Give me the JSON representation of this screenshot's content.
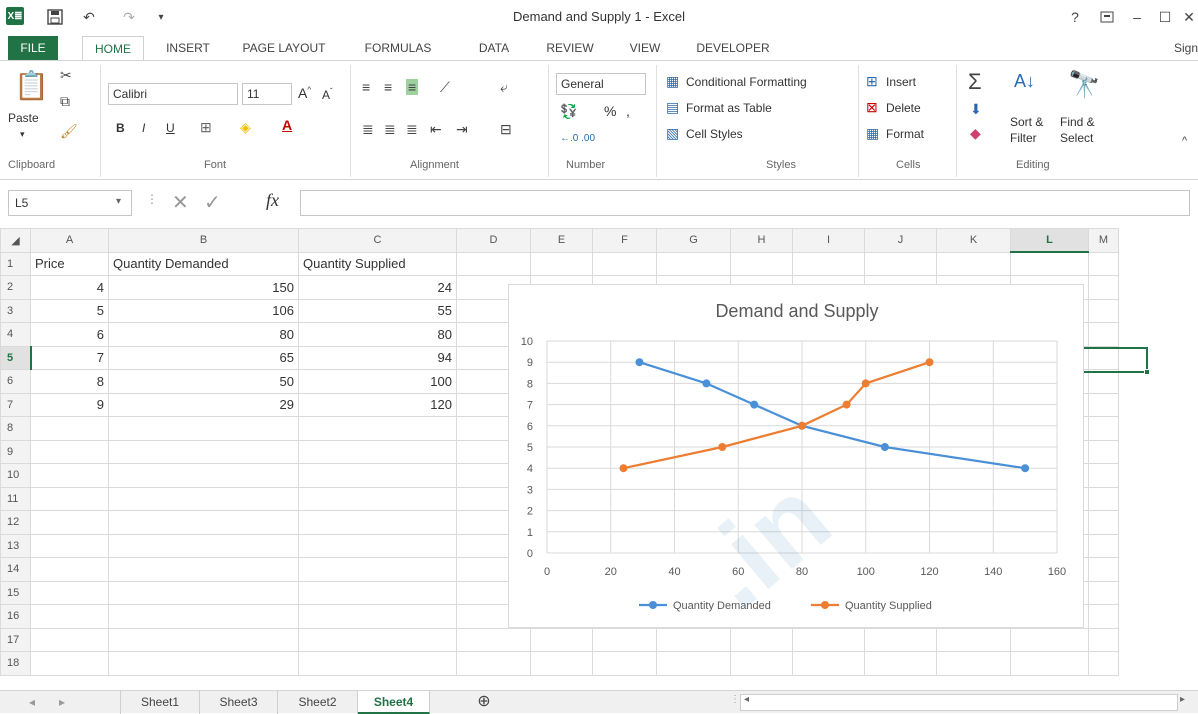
{
  "window": {
    "title": "Demand and Supply 1 - Excel",
    "app_logo": "X≣",
    "help": "?",
    "sign_in": "Sign"
  },
  "ribbon_tabs": [
    "FILE",
    "HOME",
    "INSERT",
    "PAGE LAYOUT",
    "FORMULAS",
    "DATA",
    "REVIEW",
    "VIEW",
    "DEVELOPER"
  ],
  "ribbon": {
    "clipboard": {
      "paste": "Paste",
      "label": "Clipboard"
    },
    "font": {
      "name": "Calibri",
      "size": "11",
      "label": "Font",
      "bold": "B",
      "italic": "I",
      "underline": "U"
    },
    "alignment": {
      "label": "Alignment"
    },
    "number": {
      "format": "General",
      "percent": "%",
      "comma": ",",
      "label": "Number"
    },
    "styles": {
      "conditional": "Conditional Formatting",
      "format_table": "Format as Table",
      "cell_styles": "Cell Styles",
      "label": "Styles"
    },
    "cells": {
      "insert": "Insert",
      "delete": "Delete",
      "format": "Format",
      "label": "Cells"
    },
    "editing": {
      "sort_filter_1": "Sort &",
      "sort_filter_2": "Filter",
      "find_select_1": "Find &",
      "find_select_2": "Select",
      "label": "Editing"
    }
  },
  "formula_bar": {
    "name_box": "L5",
    "fx": "fx",
    "formula": ""
  },
  "grid": {
    "columns": [
      "A",
      "B",
      "C",
      "D",
      "E",
      "F",
      "G",
      "H",
      "I",
      "J",
      "K",
      "L",
      "M"
    ],
    "rows": [
      "1",
      "2",
      "3",
      "4",
      "5",
      "6",
      "7",
      "8",
      "9",
      "10",
      "11",
      "12",
      "13",
      "14",
      "15",
      "16",
      "17",
      "18"
    ],
    "selected_column": "L",
    "selected_row": "5",
    "headers": [
      "Price",
      "Quantity Demanded",
      "Quantity Supplied"
    ],
    "data": [
      [
        "4",
        "150",
        "24"
      ],
      [
        "5",
        "106",
        "55"
      ],
      [
        "6",
        "80",
        "80"
      ],
      [
        "7",
        "65",
        "94"
      ],
      [
        "8",
        "50",
        "100"
      ],
      [
        "9",
        "29",
        "120"
      ]
    ]
  },
  "chart_data": {
    "type": "scatter",
    "title": "Demand and Supply",
    "xlabel": "",
    "ylabel": "",
    "xlim": [
      0,
      160
    ],
    "ylim": [
      0,
      10
    ],
    "x_ticks": [
      "0",
      "20",
      "40",
      "60",
      "80",
      "100",
      "120",
      "140",
      "160"
    ],
    "y_ticks": [
      "0",
      "1",
      "2",
      "3",
      "4",
      "5",
      "6",
      "7",
      "8",
      "9",
      "10"
    ],
    "grid": true,
    "legend": "bottom",
    "series": [
      {
        "name": "Quantity Demanded",
        "color": "#4a90d9",
        "points": [
          [
            150,
            4
          ],
          [
            106,
            5
          ],
          [
            80,
            6
          ],
          [
            65,
            7
          ],
          [
            50,
            8
          ],
          [
            29,
            9
          ]
        ]
      },
      {
        "name": "Quantity Supplied",
        "color": "#ed7d31",
        "points": [
          [
            24,
            4
          ],
          [
            55,
            5
          ],
          [
            80,
            6
          ],
          [
            94,
            7
          ],
          [
            100,
            8
          ],
          [
            120,
            9
          ]
        ]
      }
    ]
  },
  "sheet_tabs": [
    "Sheet1",
    "Sheet3",
    "Sheet2",
    "Sheet4"
  ],
  "active_sheet": "Sheet4",
  "colors": {
    "accent": "#217346"
  }
}
